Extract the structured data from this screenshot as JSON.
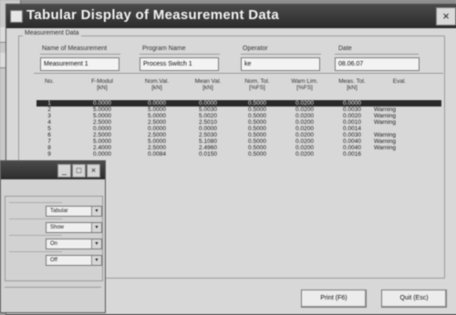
{
  "window": {
    "title": "Tabular Display of Measurement Data",
    "close_glyph": "×",
    "group_label": "Measurement Data"
  },
  "fields": [
    {
      "label": "Name of Measurement",
      "value": "Measurement 1"
    },
    {
      "label": "Program Name",
      "value": "Process Switch 1"
    },
    {
      "label": "Operator",
      "value": "ke"
    },
    {
      "label": "Date",
      "value": "08.06.07"
    }
  ],
  "table": {
    "columns": [
      {
        "name": "No.",
        "unit": ""
      },
      {
        "name": "F-Modul",
        "unit": "[kN]"
      },
      {
        "name": "Nom.Val.",
        "unit": "[kN]"
      },
      {
        "name": "Mean Val.",
        "unit": "[kN]"
      },
      {
        "name": "Nom. Tol.",
        "unit": "[%FS]"
      },
      {
        "name": "Warn Lim.",
        "unit": "[%FS]"
      },
      {
        "name": "Meas. Tol.",
        "unit": "[kN]"
      },
      {
        "name": "Eval.",
        "unit": ""
      }
    ],
    "rows": [
      [
        "1",
        "0.0000",
        "0.0000",
        "0.0000",
        "0.5000",
        "0.0200",
        "0.0000",
        ""
      ],
      [
        "2",
        "5.0000",
        "5.0000",
        "5.0030",
        "0.5000",
        "0.0200",
        "0.0030",
        "Warning"
      ],
      [
        "3",
        "5.0000",
        "5.0000",
        "5.0020",
        "0.5000",
        "0.0200",
        "0.0020",
        "Warning"
      ],
      [
        "4",
        "2.5000",
        "2.5000",
        "2.5010",
        "0.5000",
        "0.0200",
        "0.0010",
        "Warning"
      ],
      [
        "5",
        "0.0000",
        "0.0000",
        "0.0000",
        "0.5000",
        "0.0200",
        "0.0014",
        ""
      ],
      [
        "6",
        "2.5000",
        "2.5000",
        "2.5030",
        "0.5000",
        "0.0200",
        "0.0030",
        "Warning"
      ],
      [
        "7",
        "5.0000",
        "5.0000",
        "5.1080",
        "0.5000",
        "0.0200",
        "0.0040",
        "Warning"
      ],
      [
        "8",
        "2.4000",
        "2.5000",
        "2.4960",
        "0.5000",
        "0.0200",
        "0.0040",
        "Warning"
      ],
      [
        "9",
        "0.0000",
        "0.0084",
        "0.0150",
        "0.5000",
        "0.0200",
        "0.0016",
        ""
      ]
    ],
    "selected_row": 0
  },
  "buttons": {
    "print": "Print (F6)",
    "quit": "Quit (Esc)"
  },
  "sub_window": {
    "combos": [
      "Tabular",
      "Show",
      "On",
      "Off"
    ]
  }
}
